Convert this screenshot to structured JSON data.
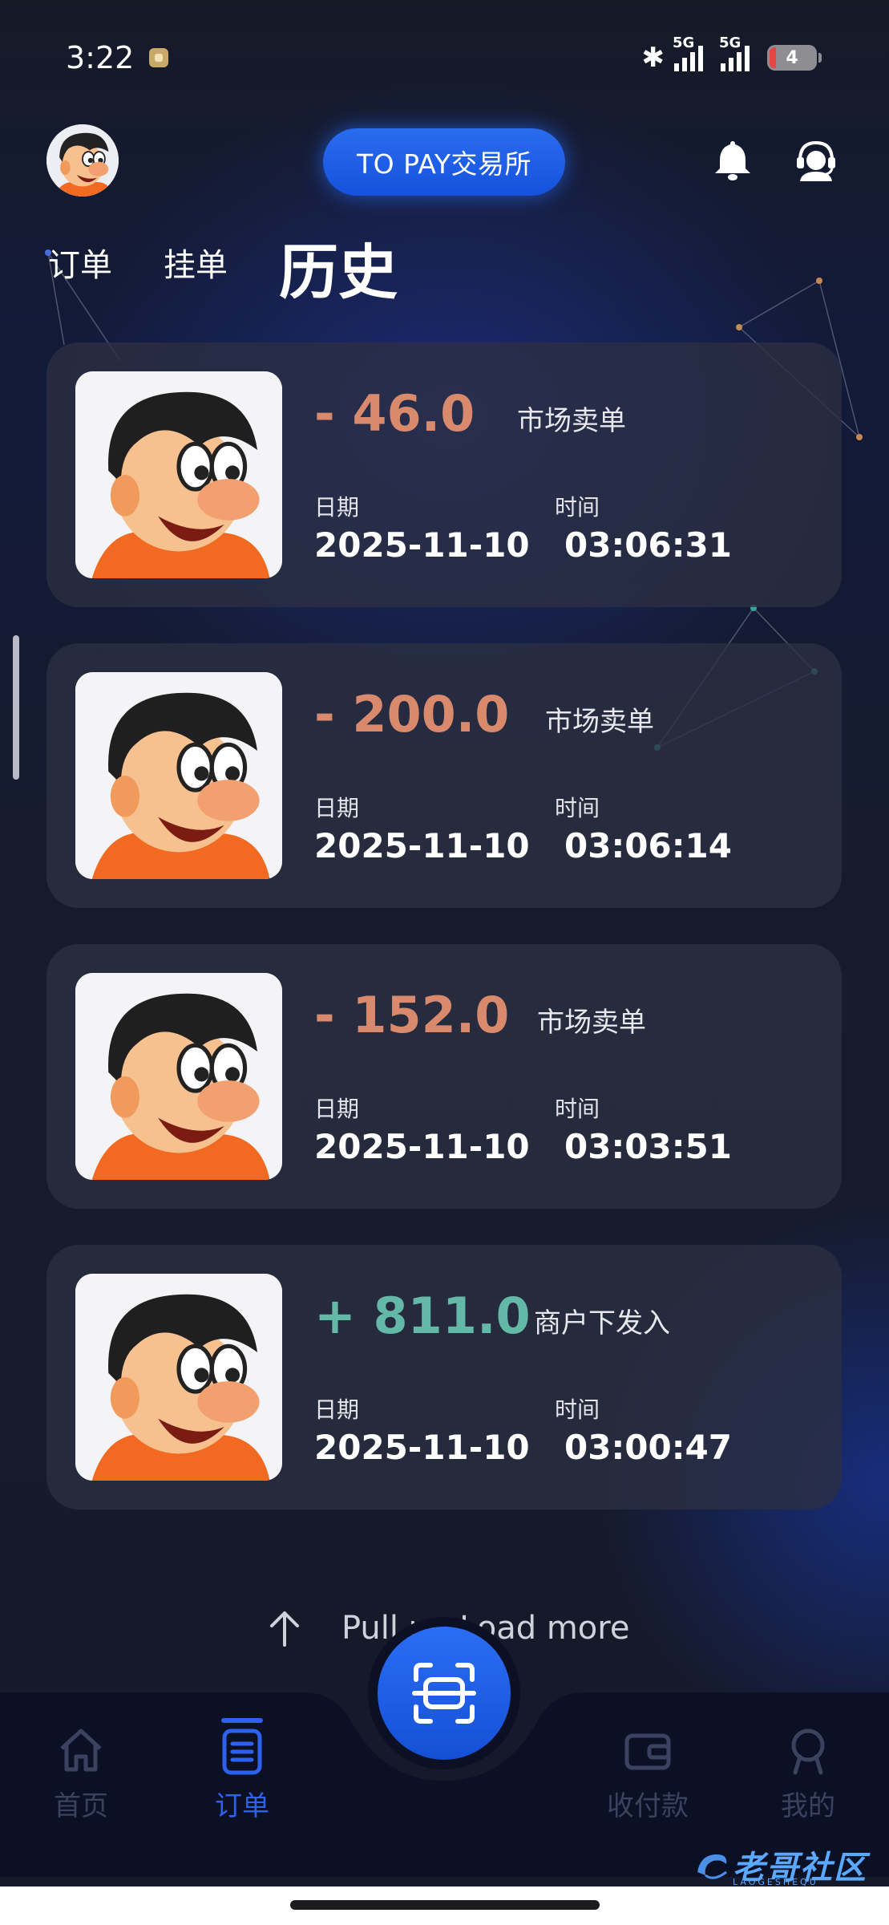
{
  "status_bar": {
    "time": "3:22",
    "network_1": "5G",
    "network_2": "5G",
    "battery": "4"
  },
  "header": {
    "brand": "TO PAY交易所",
    "icons": [
      "avatar",
      "bell-icon",
      "support-agent-icon"
    ]
  },
  "tabs": {
    "orders": "订单",
    "pending": "挂单",
    "history": "历史",
    "active": "history"
  },
  "records": [
    {
      "amount": "- 46.0",
      "sign": "negative",
      "type": "市场卖单",
      "date_label": "日期",
      "date": "2025-11-10",
      "time_label": "时间",
      "time": "03:06:31"
    },
    {
      "amount": "- 200.0",
      "sign": "negative",
      "type": "市场卖单",
      "date_label": "日期",
      "date": "2025-11-10",
      "time_label": "时间",
      "time": "03:06:14"
    },
    {
      "amount": "- 152.0",
      "sign": "negative",
      "type": "市场卖单",
      "date_label": "日期",
      "date": "2025-11-10",
      "time_label": "时间",
      "time": "03:03:51"
    },
    {
      "amount": "+ 811.0",
      "sign": "positive",
      "type": "商户下发入",
      "date_label": "日期",
      "date": "2025-11-10",
      "time_label": "时间",
      "time": "03:00:47"
    }
  ],
  "load_more": "Pull up Load more",
  "bottom_nav": {
    "home": "首页",
    "orders": "订单",
    "pay": "收付款",
    "me": "我的",
    "active": "orders"
  },
  "watermark": {
    "text": "老哥社区",
    "sub": "LAOGESHEQU"
  },
  "colors": {
    "accent_blue": "#2d62f0",
    "negative_amount": "#d98a6d",
    "positive_amount": "#63b8a8",
    "card_bg": "#2c3042"
  }
}
